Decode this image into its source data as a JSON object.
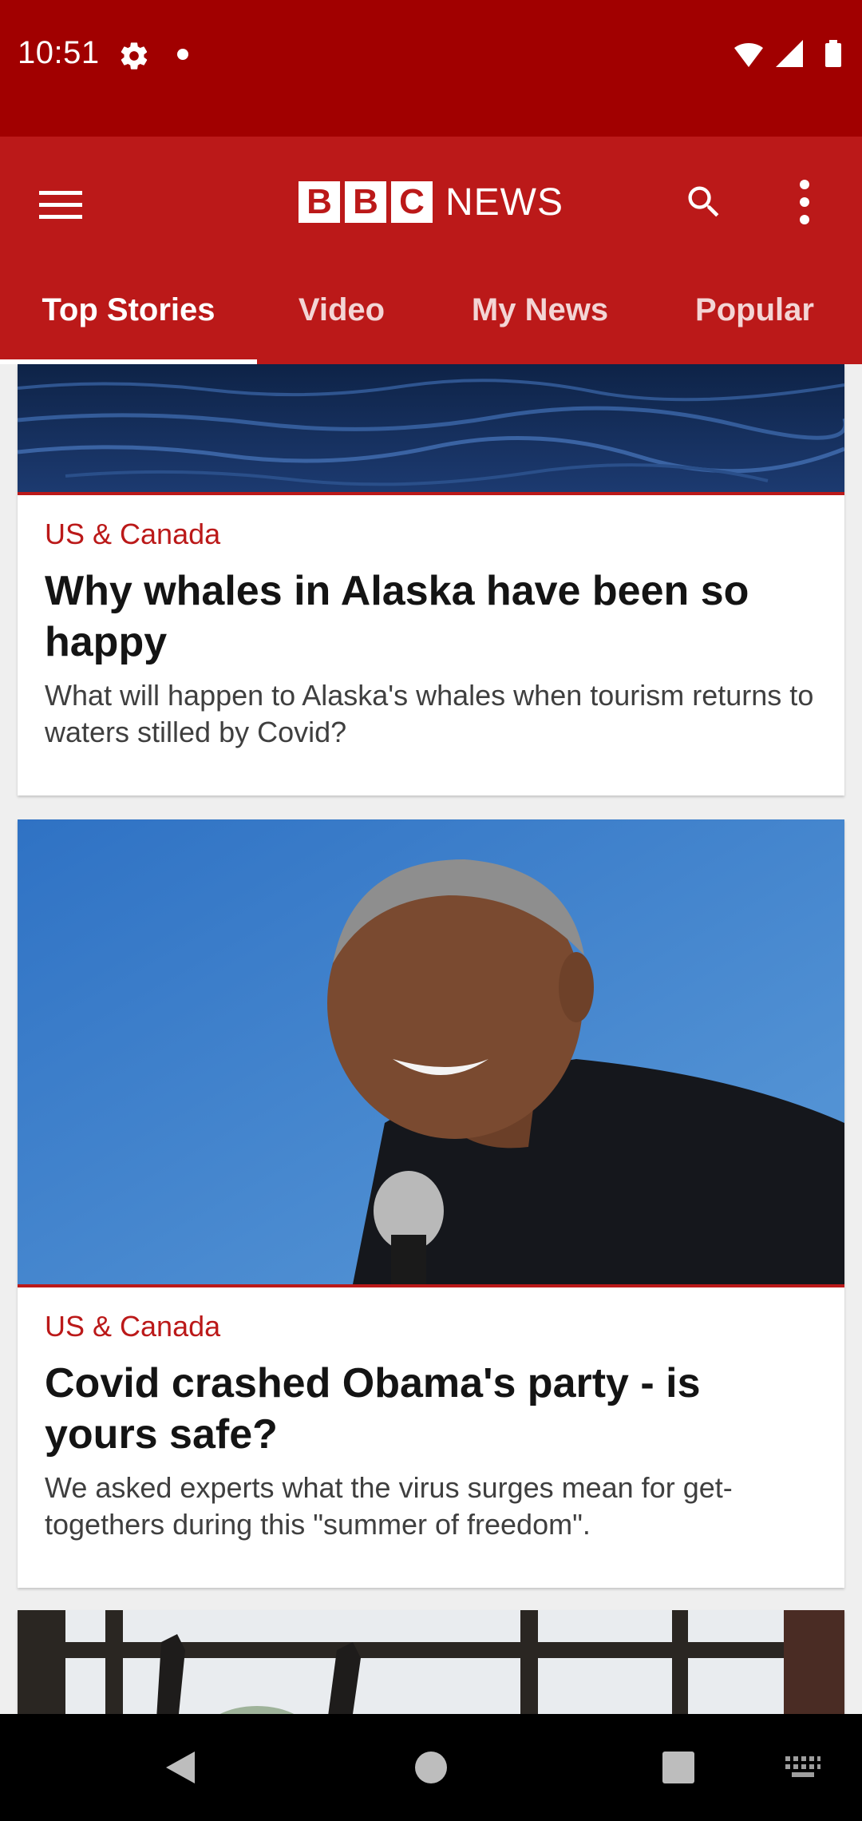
{
  "status_bar": {
    "time": "10:51"
  },
  "app_bar": {
    "logo_letters": [
      "B",
      "B",
      "C"
    ],
    "logo_word": "NEWS",
    "tabs": [
      {
        "label": "Top Stories",
        "active": true
      },
      {
        "label": "Video",
        "active": false
      },
      {
        "label": "My News",
        "active": false
      },
      {
        "label": "Popular",
        "active": false
      }
    ]
  },
  "articles": [
    {
      "section": "US & Canada",
      "title": "Why whales in Alaska have been so happy",
      "summary": "What will happen to Alaska's whales when tourism returns to waters stilled by Covid?"
    },
    {
      "section": "US & Canada",
      "title": "Covid crashed Obama's party - is yours safe?",
      "summary": "We asked experts what the virus surges mean for get-togethers during this \"summer of freedom\"."
    }
  ],
  "colors": {
    "status_bar": "#a10000",
    "brand_red": "#bb1919",
    "background": "#efefef"
  },
  "icons": {
    "status": [
      "gear-icon",
      "notification-dot-icon",
      "wifi-icon",
      "signal-icon",
      "battery-icon"
    ],
    "app_bar": [
      "menu-icon",
      "search-icon",
      "more-vert-icon"
    ],
    "nav": [
      "back-icon",
      "home-icon",
      "recents-icon",
      "keyboard-icon"
    ]
  }
}
